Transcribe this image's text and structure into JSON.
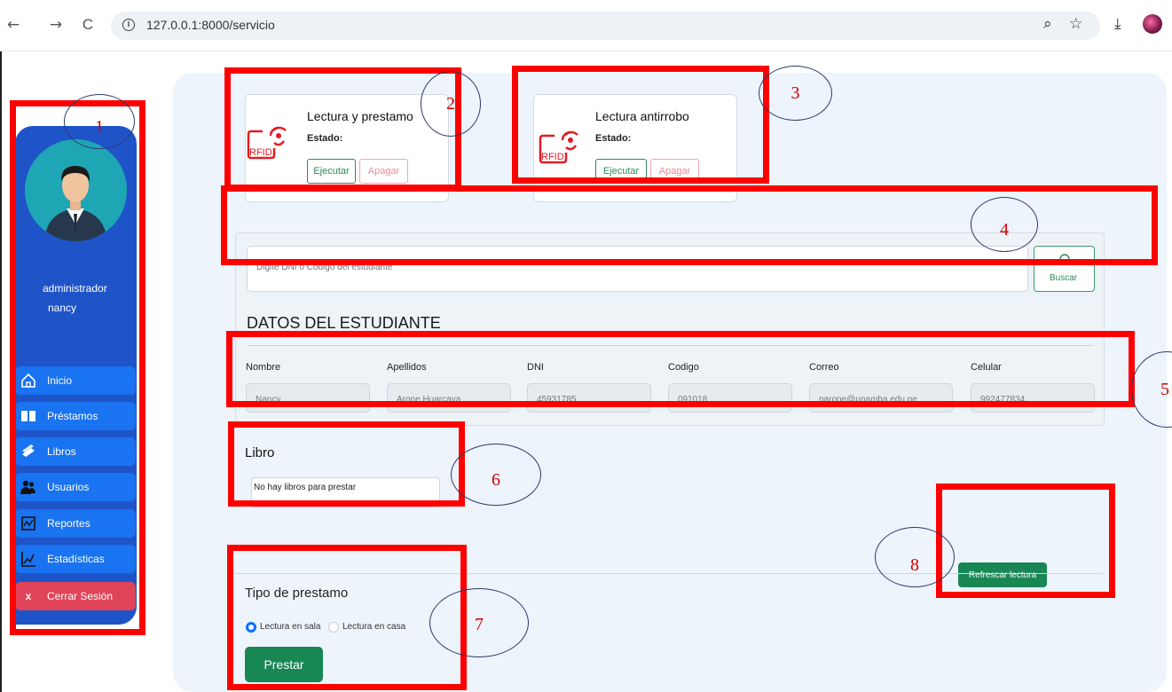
{
  "browser": {
    "url": "127.0.0.1:8000/servicio",
    "back_icon": "←",
    "forward_icon": "→",
    "reload_icon": "C",
    "info_icon": "i",
    "zoom_icon": "⌕",
    "star_icon": "☆",
    "download_icon": "⤓"
  },
  "sidebar": {
    "role": "administrador",
    "username": "nancy",
    "items": [
      {
        "label": "Inicio",
        "icon": "home-icon"
      },
      {
        "label": "Préstamos",
        "icon": "book-open-icon"
      },
      {
        "label": "Libros",
        "icon": "books-icon"
      },
      {
        "label": "Usuarios",
        "icon": "users-icon"
      },
      {
        "label": "Reportes",
        "icon": "report-icon"
      },
      {
        "label": "Estadísticas",
        "icon": "statistics-icon"
      }
    ],
    "logout_icon_glyph": "x",
    "logout": "Cerrar Sesión"
  },
  "cards": [
    {
      "title": "Lectura y prestamo",
      "status_label": "Estado:",
      "run": "Ejecutar",
      "stop": "Apagar",
      "rfid_text": "RFID"
    },
    {
      "title": "Lectura antirrobo",
      "status_label": "Estado:",
      "run": "Ejecutar",
      "stop": "Apagar",
      "rfid_text": "RFID"
    }
  ],
  "search": {
    "placeholder": "Digite DNI o Codigo del estudiante",
    "button": "Buscar"
  },
  "student": {
    "heading": "DATOS DEL ESTUDIANTE",
    "labels": [
      "Nombre",
      "Apellidos",
      "DNI",
      "Codigo",
      "Correo",
      "Celular"
    ],
    "values": [
      "Nancy",
      "Arone Huarcaya",
      "45931785",
      "091018",
      "narone@unamba.edu.pe",
      "992477834"
    ]
  },
  "libro": {
    "heading": "Libro",
    "value": "No hay libros para prestar"
  },
  "refresh_button": "Refrescar lectura",
  "loan": {
    "heading": "Tipo de prestamo",
    "options": [
      "Lectura en sala",
      "Lectura en casa"
    ],
    "selected": "Lectura en sala",
    "button": "Prestar"
  },
  "annotations": [
    "1",
    "2",
    "3",
    "4",
    "5",
    "6",
    "7",
    "8"
  ],
  "colors": {
    "sidebar": "#1f54c9",
    "sidebar_item": "#1a73f0",
    "logout": "#e04458",
    "primary_green": "#198754",
    "annotation_box": "#ff0000",
    "annotation_number": "#d10000"
  }
}
